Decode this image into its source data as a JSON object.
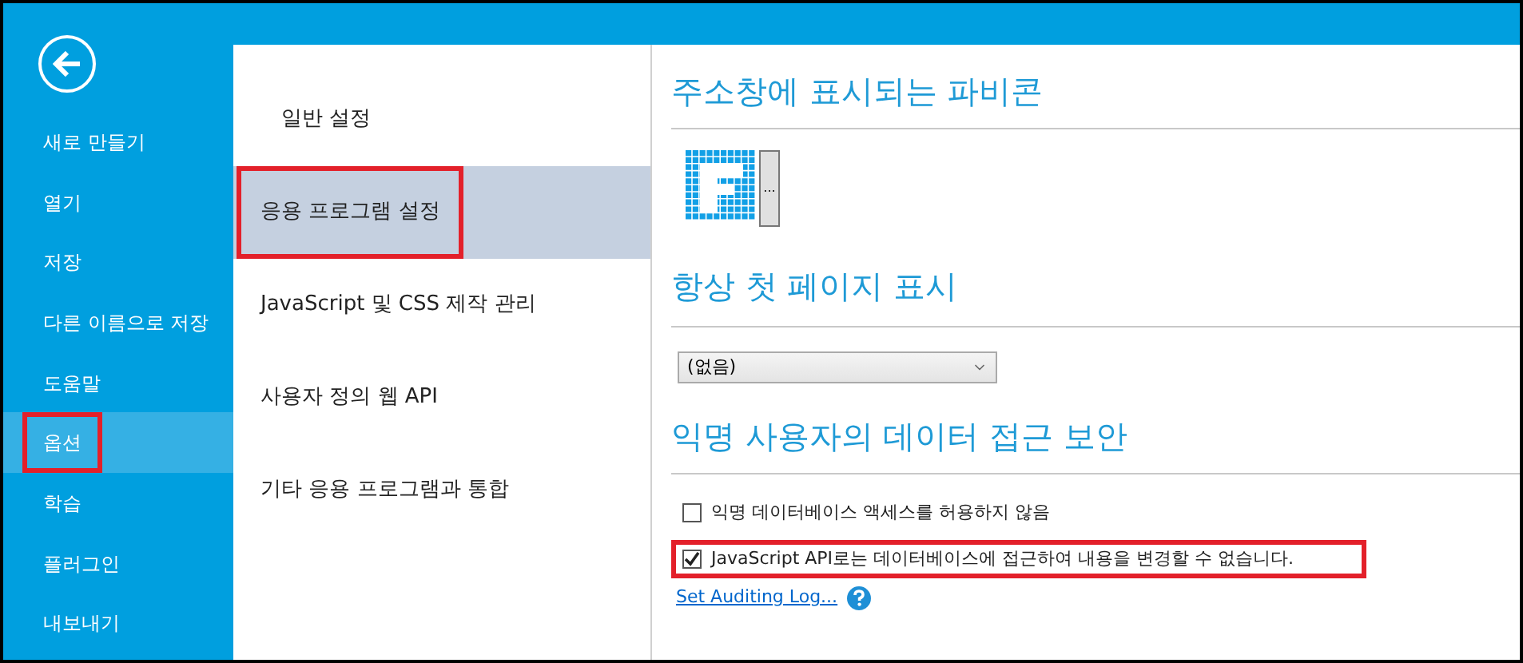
{
  "sidebar": {
    "items": [
      {
        "label": "새로 만들기",
        "selected": false,
        "annotated": false
      },
      {
        "label": "열기",
        "selected": false,
        "annotated": false
      },
      {
        "label": "저장",
        "selected": false,
        "annotated": false
      },
      {
        "label": "다른 이름으로 저장",
        "selected": false,
        "annotated": false
      },
      {
        "label": "도움말",
        "selected": false,
        "annotated": false
      },
      {
        "label": "옵션",
        "selected": true,
        "annotated": true
      },
      {
        "label": "학습",
        "selected": false,
        "annotated": false
      },
      {
        "label": "플러그인",
        "selected": false,
        "annotated": false
      },
      {
        "label": "내보내기",
        "selected": false,
        "annotated": false
      }
    ]
  },
  "categories": [
    {
      "label": "일반 설정",
      "selected": false,
      "annotated": false
    },
    {
      "label": "응용 프로그램 설정",
      "selected": true,
      "annotated": true
    },
    {
      "label": "JavaScript 및 CSS 제작 관리",
      "selected": false,
      "annotated": false
    },
    {
      "label": "사용자 정의 웹 API",
      "selected": false,
      "annotated": false
    },
    {
      "label": "기타 응용 프로그램과 통합",
      "selected": false,
      "annotated": false
    }
  ],
  "favicon": {
    "heading": "주소창에 표시되는 파비콘",
    "browse_button": "..."
  },
  "first_page": {
    "heading": "항상 첫 페이지 표시",
    "dropdown_value": "(없음)"
  },
  "security": {
    "heading": "익명 사용자의 데이터 접근 보안",
    "options": [
      {
        "label": "익명 데이터베이스 액세스를 허용하지 않음",
        "checked": false,
        "annotated": false
      },
      {
        "label": "JavaScript API로는 데이터베이스에 접근하여 내용을 변경할 수 없습니다.",
        "checked": true,
        "annotated": true
      }
    ],
    "link": "Set Auditing Log..."
  }
}
